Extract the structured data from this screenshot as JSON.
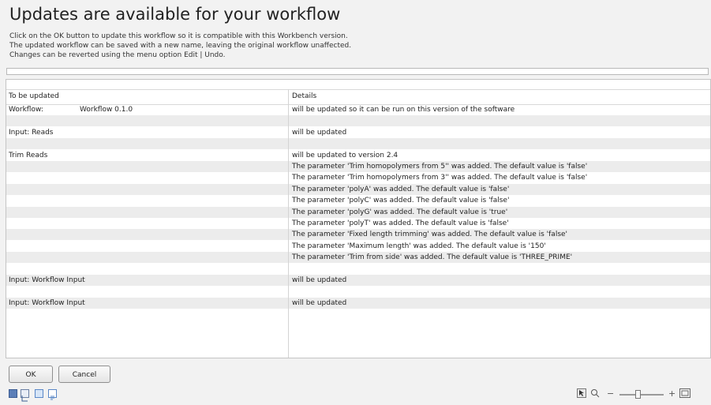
{
  "header": {
    "title": "Updates are available for your workflow",
    "desc_line1": "Click on the OK button to update this workflow so it is compatible with this Workbench version.",
    "desc_line2": "The updated workflow can be saved with a new name, leaving the original workflow unaffected.",
    "desc_line3": "Changes can be reverted using the menu option Edit | Undo."
  },
  "table": {
    "col1_header": "To be updated",
    "col2_header": "Details",
    "rows": [
      {
        "c1": "Workflow:",
        "c1b": "Workflow 0.1.0",
        "c2": "will be updated so it can be run on this version of the software"
      },
      {
        "c1": "",
        "c1b": "",
        "c2": ""
      },
      {
        "c1": "Input: Reads",
        "c1b": "",
        "c2": "will be updated"
      },
      {
        "c1": "",
        "c1b": "",
        "c2": ""
      },
      {
        "c1": "Trim Reads",
        "c1b": "",
        "c2": "will be updated to version 2.4"
      },
      {
        "c1": "",
        "c1b": "",
        "c2": "The parameter 'Trim homopolymers from 5'' was added. The default value is 'false'"
      },
      {
        "c1": "",
        "c1b": "",
        "c2": "The parameter 'Trim homopolymers from 3'' was added. The default value is 'false'"
      },
      {
        "c1": "",
        "c1b": "",
        "c2": "The parameter 'polyA' was added. The default value is 'false'"
      },
      {
        "c1": "",
        "c1b": "",
        "c2": "The parameter 'polyC' was added. The default value is 'false'"
      },
      {
        "c1": "",
        "c1b": "",
        "c2": "The parameter 'polyG' was added. The default value is 'true'"
      },
      {
        "c1": "",
        "c1b": "",
        "c2": "The parameter 'polyT' was added. The default value is 'false'"
      },
      {
        "c1": "",
        "c1b": "",
        "c2": "The parameter 'Fixed length trimming' was added. The default value is 'false'"
      },
      {
        "c1": "",
        "c1b": "",
        "c2": "The parameter 'Maximum length' was added. The default value is '150'"
      },
      {
        "c1": "",
        "c1b": "",
        "c2": "The parameter 'Trim from side' was added. The default value is 'THREE_PRIME'"
      },
      {
        "c1": "",
        "c1b": "",
        "c2": ""
      },
      {
        "c1": "Input: Workflow Input",
        "c1b": "",
        "c2": "will be updated"
      },
      {
        "c1": "",
        "c1b": "",
        "c2": ""
      },
      {
        "c1": "Input: Workflow Input",
        "c1b": "",
        "c2": "will be updated"
      }
    ]
  },
  "buttons": {
    "ok": "OK",
    "cancel": "Cancel"
  },
  "toolbar_icons": [
    "workflow-editor-icon",
    "layout-icon",
    "grid-icon",
    "document-icon"
  ],
  "zoom": {
    "minus": "−",
    "plus": "+",
    "mode_icons": [
      "select-mode-icon",
      "zoom-mode-icon",
      "fit-icon"
    ]
  }
}
